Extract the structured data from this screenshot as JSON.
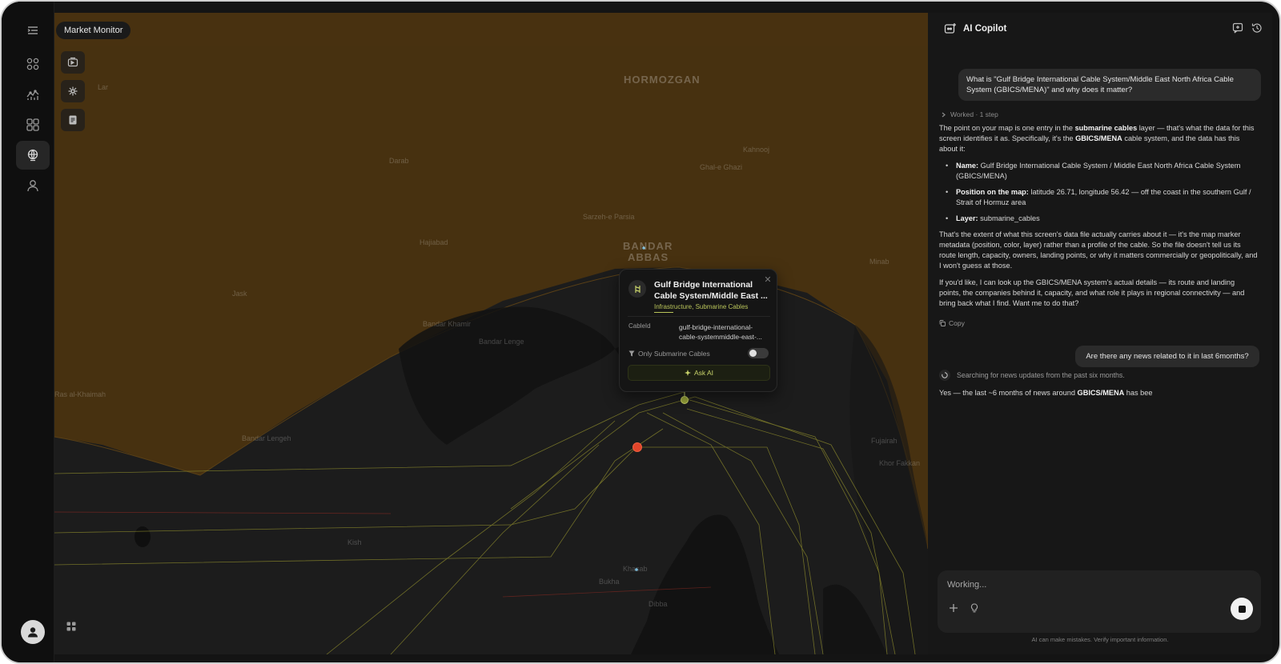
{
  "app": {
    "title": "Market Monitor"
  },
  "map": {
    "labels": [
      {
        "text": "HORMOZGAN",
        "big": true
      },
      {
        "text": "BANDAR",
        "big": true
      },
      {
        "text": "ABBAS",
        "big": true
      },
      {
        "text": "Lar"
      },
      {
        "text": "Darab"
      },
      {
        "text": "Hajiabad"
      },
      {
        "text": "Ghal-e Ghazi"
      },
      {
        "text": "Sarzeh-e Parsia"
      },
      {
        "text": "Kahnooj"
      },
      {
        "text": "Minab"
      },
      {
        "text": "Jask"
      },
      {
        "text": "Bandar Khamir"
      },
      {
        "text": "Bandar Lenge"
      },
      {
        "text": "Bandar Lengeh"
      },
      {
        "text": "Kish"
      },
      {
        "text": "Khasab"
      },
      {
        "text": "Bukha"
      },
      {
        "text": "Dibba"
      },
      {
        "text": "Fujairah"
      },
      {
        "text": "Khor Fakkan"
      },
      {
        "text": "Ras al-Khaimah"
      }
    ],
    "accent_color": "#c8d36a",
    "marker_color": "#e2452b"
  },
  "popup": {
    "title": "Gulf Bridge International Cable System/Middle East ...",
    "tags": "Infrastructure, Submarine Cables",
    "key": "CableId",
    "value": "gulf-bridge-international-cable-systemmiddle-east-...",
    "filter_label": "Only Submarine Cables",
    "ask_label": "Ask AI"
  },
  "copilot": {
    "title": "AI Copilot",
    "user_message_1": "What is \"Gulf Bridge International Cable System/Middle East North Africa Cable System (GBICS/MENA)\" and why does it matter?",
    "worked": "Worked · 1 step",
    "answer": {
      "intro": [
        "The point on your map is one entry in the ",
        "submarine cables",
        " layer — that's what the data for this screen identifies it as. Specifically, it's the ",
        "GBICS/MENA",
        " cable system, and the data has this about it:"
      ],
      "items": [
        {
          "label": "Name:",
          "text": " Gulf Bridge International Cable System / Middle East North Africa Cable System (GBICS/MENA)"
        },
        {
          "label": "Position on the map:",
          "text": " latitude 26.71, longitude 56.42 — off the coast in the southern Gulf / Strait of Hormuz area"
        },
        {
          "label": "Layer:",
          "text": " submarine_cables"
        }
      ],
      "para2": "That's the extent of what this screen's data file actually carries about it — it's the map marker metadata (position, color, layer) rather than a profile of the cable. So the file doesn't tell us its route length, capacity, owners, landing points, or why it matters commercially or geopolitically, and I won't guess at those.",
      "para3": "If you'd like, I can look up the GBICS/MENA system's actual details — its route and landing points, the companies behind it, capacity, and what role it plays in regional connectivity — and bring back what I find. Want me to do that?"
    },
    "copy_label": "Copy",
    "user_message_2": "Are there any  news related to it in last 6months?",
    "search_status": "Searching for news updates from the past six months.",
    "stream": [
      "Yes — the last ~6 months of news around ",
      "GBICS/MENA",
      " has bee"
    ],
    "input_placeholder": "Working...",
    "disclaimer": "AI can make mistakes. Verify important information."
  }
}
